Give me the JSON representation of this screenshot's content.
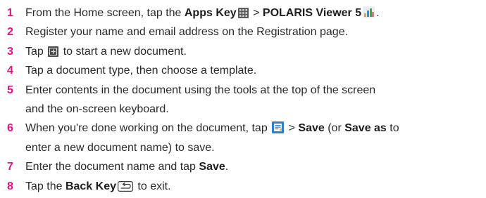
{
  "accent_color": "#e8117f",
  "steps": [
    {
      "num": "1",
      "p1": "From the Home screen, tap the ",
      "b1": "Apps Key",
      "icon1": "apps-grid-icon",
      "p2": " > ",
      "b2": "POLARIS Viewer 5",
      "icon2": "polaris-viewer-icon",
      "p3": "."
    },
    {
      "num": "2",
      "text": "Register your name and email address on the Registration page."
    },
    {
      "num": "3",
      "p1": "Tap ",
      "icon1": "new-document-plus-icon",
      "p2": " to start a new document."
    },
    {
      "num": "4",
      "text": "Tap a document type, then choose a template."
    },
    {
      "num": "5",
      "line1": "Enter contents in the document using the tools at the top of the screen",
      "line2": "and the on-screen keyboard."
    },
    {
      "num": "6",
      "p1": "When you're done working on the document, tap ",
      "icon1": "document-menu-icon",
      "p2": " > ",
      "b1": "Save",
      "p3": " (or ",
      "b2": "Save as",
      "p4": " to",
      "line2": "enter a new document name) to save."
    },
    {
      "num": "7",
      "p1": "Enter the document name and tap ",
      "b1": "Save",
      "p2": "."
    },
    {
      "num": "8",
      "p1": "Tap the ",
      "b1": "Back Key",
      "icon1": "back-key-icon",
      "p2": " to exit."
    }
  ]
}
